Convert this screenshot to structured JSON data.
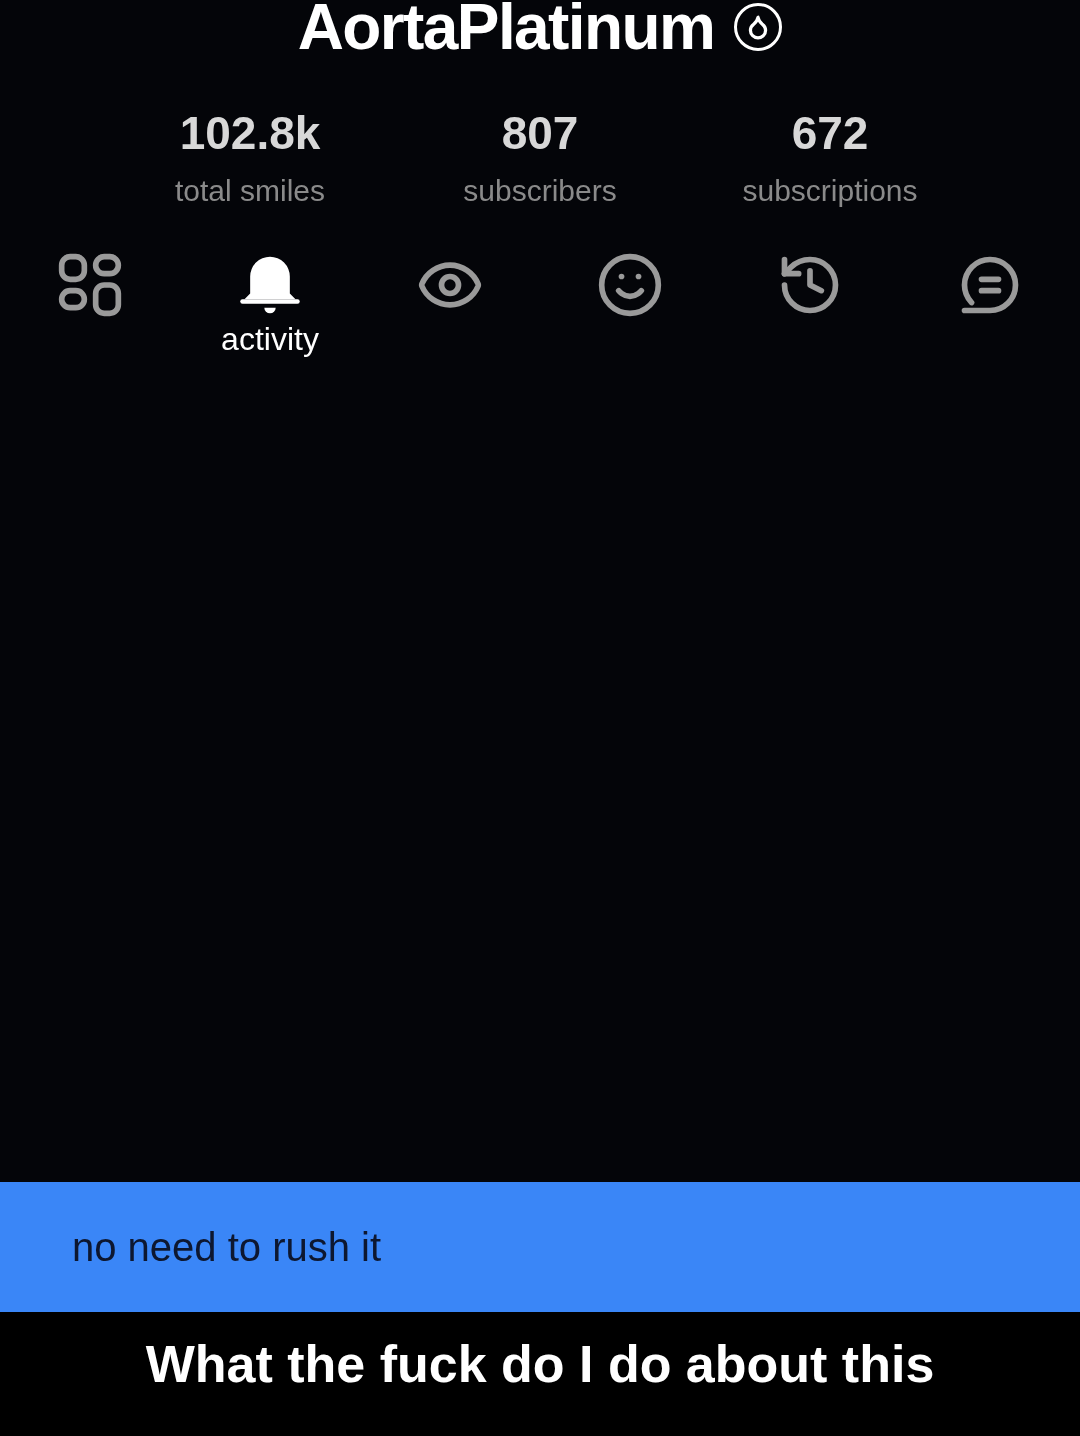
{
  "profile": {
    "name": "AortaPlatinum"
  },
  "stats": [
    {
      "value": "102.8k",
      "label": "total smiles"
    },
    {
      "value": "807",
      "label": "subscribers"
    },
    {
      "value": "672",
      "label": "subscriptions"
    }
  ],
  "tabs": [
    {
      "kind": "grid",
      "selected": false
    },
    {
      "kind": "bell",
      "selected": true,
      "label": "activity"
    },
    {
      "kind": "eye",
      "selected": false
    },
    {
      "kind": "smile",
      "selected": false
    },
    {
      "kind": "history",
      "selected": false
    },
    {
      "kind": "chat",
      "selected": false
    }
  ],
  "message": {
    "text": "no need to rush it"
  },
  "caption": "What the fuck do I do about this"
}
